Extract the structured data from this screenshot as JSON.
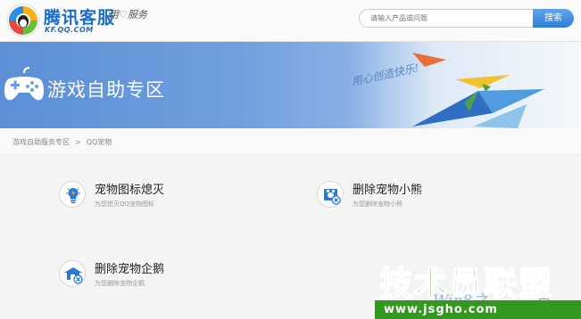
{
  "header": {
    "brand": "腾讯客服",
    "brand_sub": "KF.QQ.COM",
    "slogan_left": "用",
    "slogan_right": "服务",
    "search_placeholder": "请输入产品或问题",
    "search_button": "搜索"
  },
  "banner": {
    "title": "游戏自助专区",
    "slogan": "用心创造快乐!"
  },
  "breadcrumb": {
    "parent": "游戏自助服务专区",
    "separator": ">",
    "current": "QQ宠物"
  },
  "services": [
    {
      "name": "宠物图标熄灭",
      "desc": "为您熄灭QQ宠物图标",
      "icon": "lightbulb-icon"
    },
    {
      "name": "删除宠物小熊",
      "desc": "为您删除宠物小熊",
      "icon": "delete-bear-icon"
    },
    {
      "name": "删除宠物企鹅",
      "desc": "为您删除宠物企鹅",
      "icon": "delete-penguin-icon"
    }
  ],
  "watermark": {
    "big": "技术员联盟",
    "win": "Win8之",
    "zhijia": "家",
    "url": "www.jsgho.com"
  },
  "colors": {
    "accent": "#2f7fd9",
    "banner_blue": "#5c8fd6",
    "watermark_green": "#3f9d2a"
  }
}
